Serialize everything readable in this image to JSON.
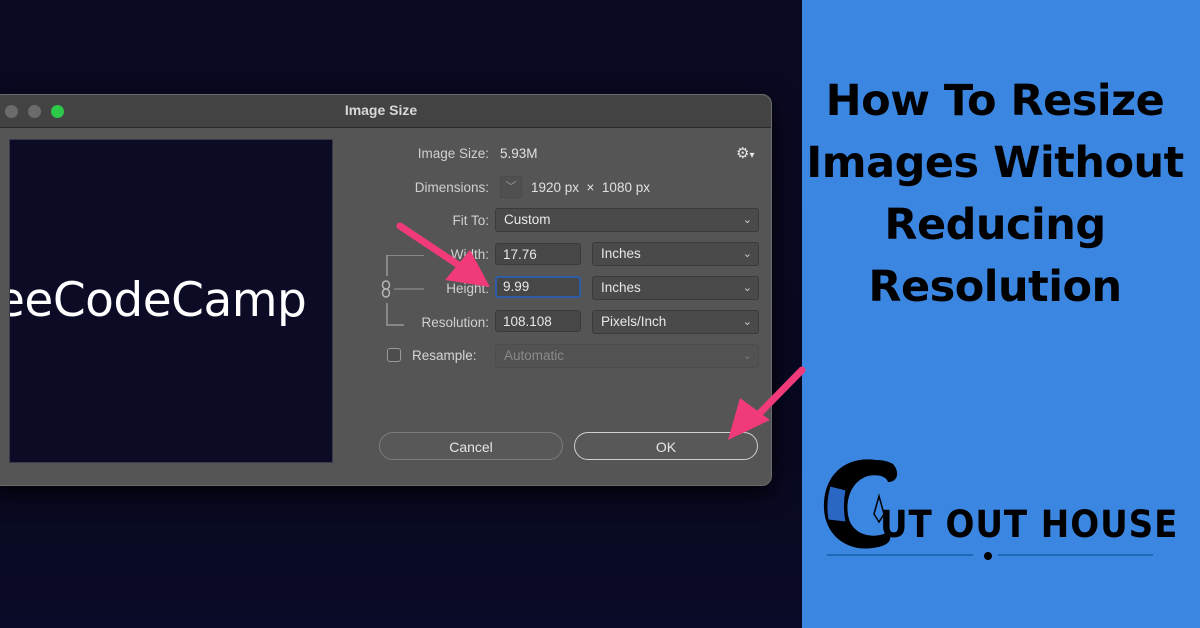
{
  "headline": {
    "lines": [
      "How To Resize",
      "Images Without",
      "Reducing",
      "Resolution"
    ]
  },
  "dialog": {
    "title": "Image Size",
    "preview_text": "eeCodeCamp",
    "image_size": {
      "label": "Image Size:",
      "value": "5.93M"
    },
    "dimensions": {
      "label": "Dimensions:",
      "value": "1920 px  ×  1080 px"
    },
    "fit_to": {
      "label": "Fit To:",
      "value": "Custom"
    },
    "width": {
      "label": "Width:",
      "value": "17.76",
      "unit": "Inches"
    },
    "height": {
      "label": "Height:",
      "value": "9.99",
      "unit": "Inches"
    },
    "resolution": {
      "label": "Resolution:",
      "value": "108.108",
      "unit": "Pixels/Inch"
    },
    "resample": {
      "label": "Resample:",
      "value": "Automatic",
      "checked": false
    },
    "buttons": {
      "cancel": "Cancel",
      "ok": "OK"
    },
    "icons": {
      "gear": "gear-icon",
      "chevron": "chevron-down-icon",
      "link": "chain-link-icon"
    }
  },
  "logo": {
    "text": "UT OUT HOUSE",
    "brand": "Cut Out House"
  },
  "colors": {
    "background": "#09091f",
    "panel_blue": "#3b86e0",
    "arrow_pink": "#f03a7a",
    "dialog_bg": "#555555",
    "focus_blue": "#2e5da8",
    "traffic_green": "#2ec84a"
  }
}
